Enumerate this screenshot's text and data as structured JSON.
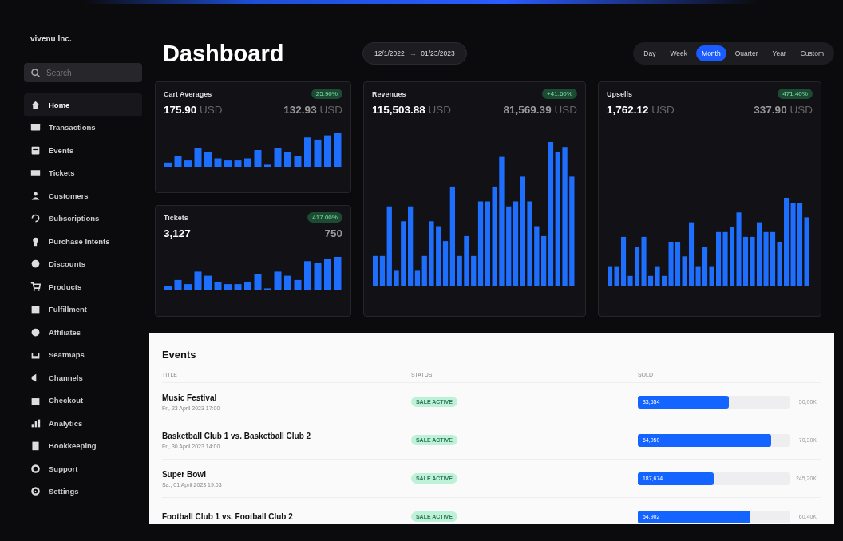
{
  "brand": "vivenu Inc.",
  "search": {
    "placeholder": "Search"
  },
  "nav": [
    {
      "label": "Home",
      "selected": true
    },
    {
      "label": "Transactions",
      "selected": false
    },
    {
      "label": "Events",
      "selected": false
    },
    {
      "label": "Tickets",
      "selected": false
    },
    {
      "label": "Customers",
      "selected": false
    },
    {
      "label": "Subscriptions",
      "selected": false
    },
    {
      "label": "Purchase Intents",
      "selected": false
    },
    {
      "label": "Discounts",
      "selected": false
    },
    {
      "label": "Products",
      "selected": false
    },
    {
      "label": "Fulfillment",
      "selected": false
    },
    {
      "label": "Affiliates",
      "selected": false
    },
    {
      "label": "Seatmaps",
      "selected": false
    },
    {
      "label": "Channels",
      "selected": false
    },
    {
      "label": "Checkout",
      "selected": false
    },
    {
      "label": "Analytics",
      "selected": false
    },
    {
      "label": "Bookkeeping",
      "selected": false
    },
    {
      "label": "Support",
      "selected": false
    },
    {
      "label": "Settings",
      "selected": false
    }
  ],
  "title": "Dashboard",
  "date_range": {
    "start": "12/1/2022",
    "arrow": "→",
    "end": "01/23/2023"
  },
  "periods": [
    {
      "label": "Day",
      "selected": false
    },
    {
      "label": "Week",
      "selected": false
    },
    {
      "label": "Month",
      "selected": true
    },
    {
      "label": "Quarter",
      "selected": false
    },
    {
      "label": "Year",
      "selected": false
    },
    {
      "label": "Custom",
      "selected": false
    }
  ],
  "cards": [
    {
      "title": "Cart Averages",
      "badge": "25.90%",
      "value": "175.90",
      "unit": "USD",
      "compare": "132.93",
      "compare_unit": "USD"
    },
    {
      "title": "Tickets",
      "badge": "417.00%",
      "value": "3,127",
      "compare": "750"
    },
    {
      "title": "Revenues",
      "badge": "+41.60%",
      "value": "115,503.88",
      "unit": "USD",
      "compare": "81,569.39",
      "compare_unit": "USD"
    },
    {
      "title": "Upsells",
      "badge": "471.40%",
      "value": "1,762.12",
      "unit": "USD",
      "compare": "337.90",
      "compare_unit": "USD"
    }
  ],
  "events": {
    "title": "Events",
    "columns": [
      "TITLE",
      "STATUS",
      "SOLD"
    ],
    "rows": [
      {
        "title": "Music Festival",
        "date": "Fr., 23 April 2023 17:00",
        "status": "SALE ACTIVE",
        "sold": "33,554",
        "total": "50,00K",
        "level": 0.6
      },
      {
        "title": "Basketball Club 1 vs. Basketball Club 2",
        "date": "Fr., 30 April 2023 14:00",
        "status": "SALE ACTIVE",
        "sold": "64,050",
        "total": "70,30K",
        "level": 0.88
      },
      {
        "title": "Super Bowl",
        "date": "Sa., 01 April 2023 19:03",
        "status": "SALE ACTIVE",
        "sold": "187,674",
        "total": "245,20K",
        "level": 0.5
      },
      {
        "title": "Football Club 1 vs. Football Club 2",
        "status": "SALE ACTIVE",
        "sold": "54,902",
        "total": "60,40K",
        "level": 0.74
      }
    ]
  }
}
